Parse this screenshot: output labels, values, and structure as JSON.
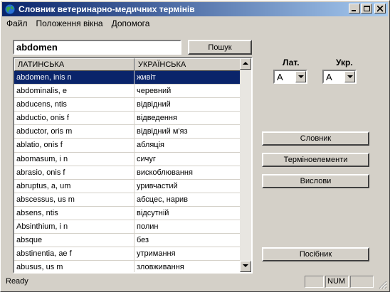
{
  "window": {
    "title": "Словник ветеринарно-медичних термінів",
    "icon": "globe-icon",
    "controls": [
      "minimize-icon",
      "maximize-icon",
      "close-icon"
    ]
  },
  "menu": [
    "Файл",
    "Положення вікна",
    "Допомога"
  ],
  "search": {
    "value": "abdomen",
    "button_label": "Пошук"
  },
  "table": {
    "headers": [
      "ЛАТИНСЬКА",
      "УКРАЇНСЬКА"
    ],
    "selected_index": 0,
    "rows": [
      [
        "abdomen, inis n",
        "живіт"
      ],
      [
        "abdominalis, e",
        "черевний"
      ],
      [
        "abducens, ntis",
        "відвідний"
      ],
      [
        "abductio, onis f",
        "відведення"
      ],
      [
        "abductor, oris m",
        "відвідний м'яз"
      ],
      [
        "ablatio, onis f",
        "абляція"
      ],
      [
        "abomasum, i n",
        "сичуг"
      ],
      [
        "abrasio, onis f",
        "вискоблювання"
      ],
      [
        "abruptus, a, um",
        "уривчастий"
      ],
      [
        "abscessus, us m",
        "абсцес, нарив"
      ],
      [
        "absens, ntis",
        "відсутній"
      ],
      [
        "Absinthium, i n",
        "полин"
      ],
      [
        "absque",
        "без"
      ],
      [
        "abstinentia, ae f",
        "утримання"
      ],
      [
        "abusus, us m",
        "зловживання"
      ]
    ]
  },
  "lang": {
    "lat_label": "Лат.",
    "ukr_label": "Укр.",
    "lat_value": "А",
    "ukr_value": "А"
  },
  "side_buttons": {
    "dictionary": "Словник",
    "term_elements": "Терміноелементи",
    "phrases": "Вислови",
    "manual": "Посібник"
  },
  "status": {
    "text": "Ready",
    "num": "NUM"
  },
  "colors": {
    "title_start": "#0a246a",
    "title_end": "#a6caf0",
    "selection": "#0a246a",
    "face": "#d4d0c8"
  }
}
